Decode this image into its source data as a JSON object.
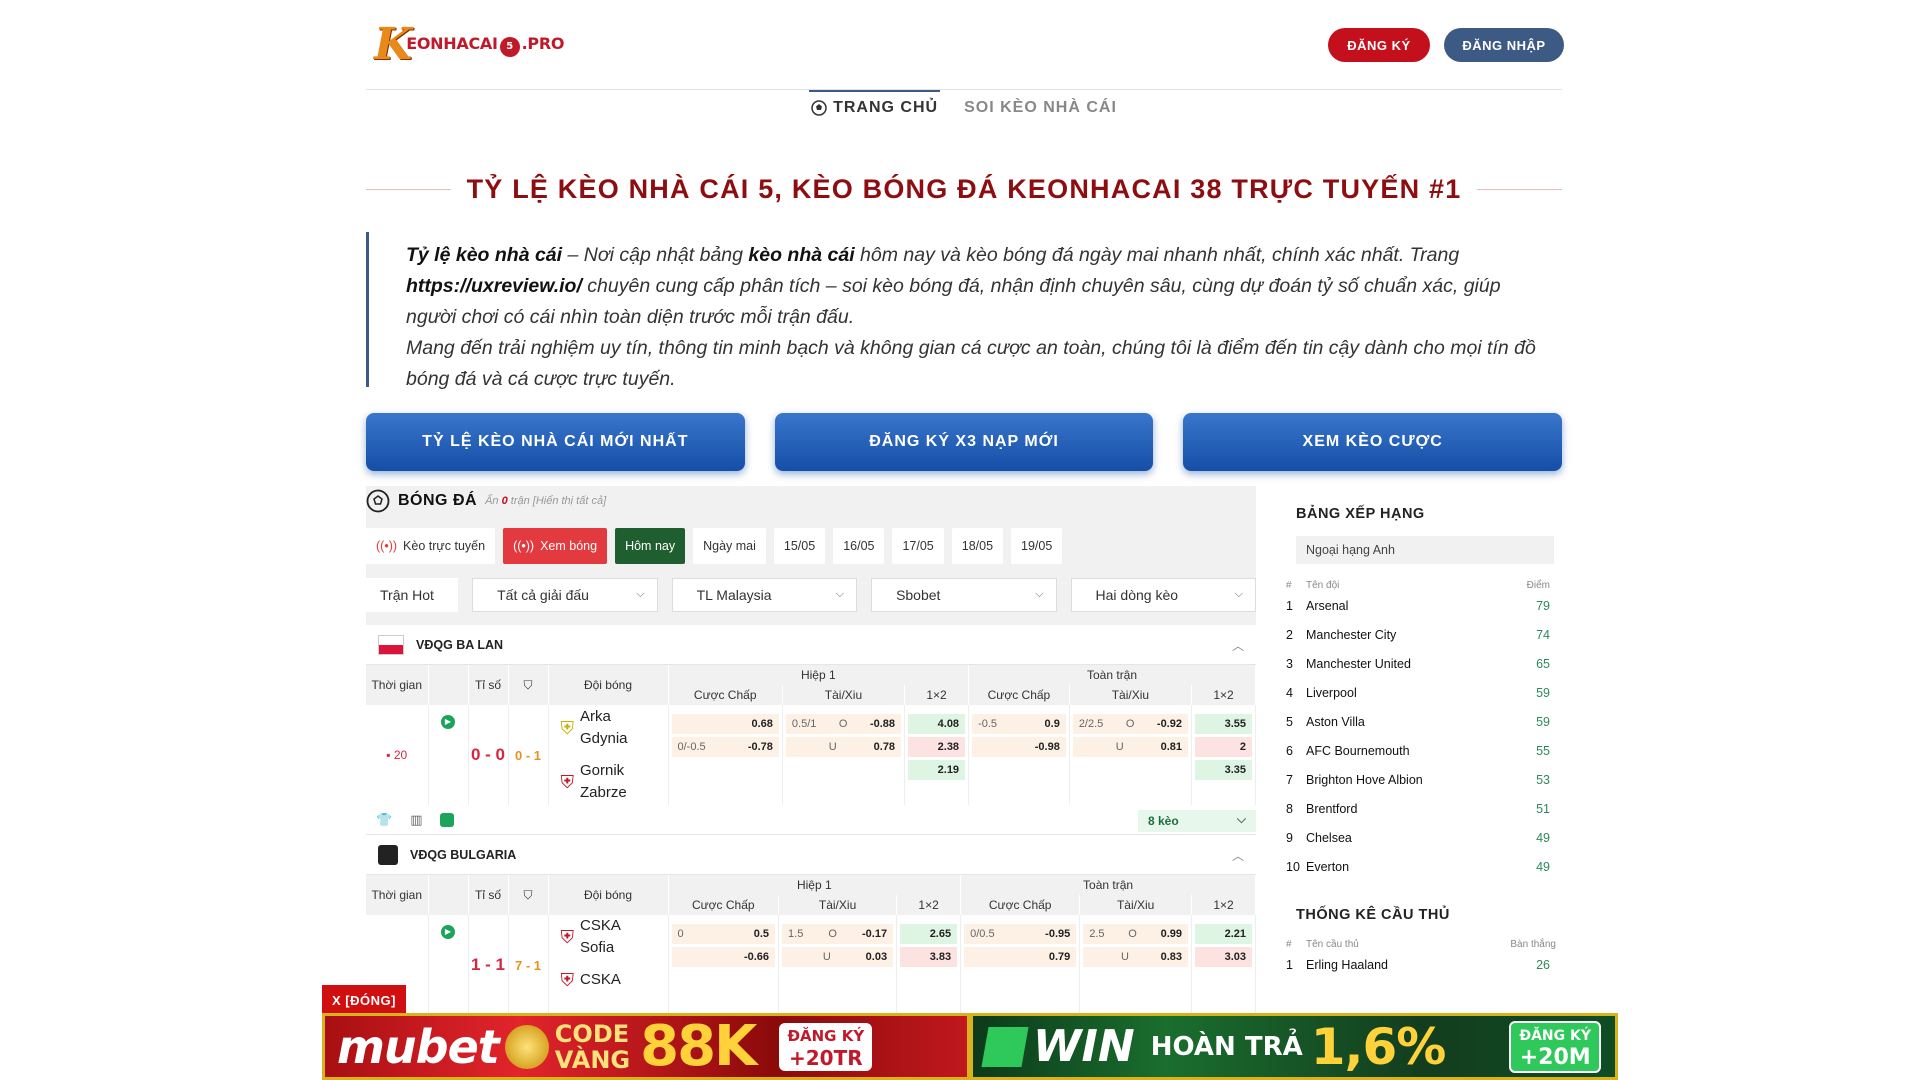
{
  "header": {
    "logo_k": "K",
    "logo_text": "EONHACAI",
    "logo_num": "5",
    "logo_tld": ".PRO",
    "register": "ĐĂNG KÝ",
    "login": "ĐĂNG NHẬP"
  },
  "nav": {
    "home": "TRANG CHỦ",
    "soi": "SOI KÈO NHÀ CÁI"
  },
  "title": "TỶ LỆ KÈO NHÀ CÁI 5, KÈO BÓNG ĐÁ KEONHACAI 38 TRỰC TUYẾN #1",
  "intro": {
    "b1": "Tỷ lệ kèo nhà cái",
    "t1": " – Nơi cập nhật bảng ",
    "b2": "kèo nhà cái",
    "t2": " hôm nay và kèo bóng đá ngày mai nhanh nhất, chính xác nhất. Trang ",
    "b3": "https://uxreview.io/",
    "t3": " chuyên cung cấp phân tích – soi kèo bóng đá, nhận định chuyên sâu, cùng dự đoán tỷ số chuẩn xác, giúp người chơi có cái nhìn toàn diện trước mỗi trận đấu.",
    "p2": "Mang đến trải nghiệm uy tín, thông tin minh bạch và không gian cá cược an toàn, chúng tôi là điểm đến tin cậy dành cho mọi tín đồ bóng đá và cá cược trực tuyến."
  },
  "bigbuttons": [
    "TỶ LỆ KÈO NHÀ CÁI MỚI NHẤT",
    "ĐĂNG KÝ X3 NẠP MỚI",
    "XEM KÈO CƯỢC"
  ],
  "section": {
    "title": "BÓNG ĐÁ",
    "sub_a": "Ẩn ",
    "sub_n": "0",
    "sub_b": " trận [Hiển thị tất cả]"
  },
  "chips": [
    "Kèo trực tuyến",
    "Xem bóng",
    "Hôm nay",
    "Ngày mai",
    "15/05",
    "16/05",
    "17/05",
    "18/05",
    "19/05"
  ],
  "filters": [
    "Trận Hot",
    "Tất cả giải đấu",
    "TL Malaysia",
    "Sbobet",
    "Hai dòng kèo"
  ],
  "table_headers": {
    "time": "Thời gian",
    "score": "Tỉ số",
    "teams": "Đội bóng",
    "h1": "Hiệp 1",
    "ft": "Toàn trận",
    "hc": "Cược Chấp",
    "ou": "Tài/Xiu",
    "x12": "1×2"
  },
  "match1": {
    "league": "VĐQG BA LAN",
    "minute": "20",
    "score": "0 - 0",
    "half": "0 - 1",
    "home": [
      "Arka",
      "Gdynia"
    ],
    "away": [
      "Gornik",
      "Zabrze"
    ],
    "h1_hc": [
      [
        "",
        "0.68"
      ],
      [
        "0/-0.5",
        "-0.78"
      ]
    ],
    "h1_ou": [
      [
        "0.5/1",
        "O",
        "-0.88"
      ],
      [
        "",
        "U",
        "0.78"
      ]
    ],
    "h1_x": [
      "4.08",
      "2.38",
      "2.19"
    ],
    "ft_hc": [
      [
        "-0.5",
        "0.9"
      ],
      [
        "",
        "-0.98"
      ]
    ],
    "ft_ou": [
      [
        "2/2.5",
        "O",
        "-0.92"
      ],
      [
        "",
        "U",
        "0.81"
      ]
    ],
    "ft_x": [
      "3.55",
      "2",
      "3.35"
    ],
    "keo": "8 kèo"
  },
  "match2": {
    "league": "VĐQG BULGARIA",
    "score": "1 - 1",
    "half": "7 - 1",
    "home": [
      "CSKA",
      "Sofia"
    ],
    "away": [
      "CSKA"
    ],
    "h1_hc": [
      [
        "0",
        "0.5"
      ],
      [
        "",
        "-0.66"
      ]
    ],
    "h1_ou": [
      [
        "1.5",
        "O",
        "-0.17"
      ],
      [
        "",
        "U",
        "0.03"
      ]
    ],
    "h1_x": [
      "2.65",
      "3.83"
    ],
    "ft_hc": [
      [
        "0/0.5",
        "-0.95"
      ],
      [
        "",
        "0.79"
      ]
    ],
    "ft_ou": [
      [
        "2.5",
        "O",
        "0.99"
      ],
      [
        "",
        "U",
        "0.83"
      ]
    ],
    "ft_x": [
      "2.21",
      "3.03"
    ]
  },
  "standings": {
    "title": "BẢNG XẾP HẠNG",
    "league": "Ngoại hạng Anh",
    "h_rank": "#",
    "h_team": "Tên đội",
    "h_pts": "Điểm",
    "rows": [
      [
        "1",
        "Arsenal",
        "79"
      ],
      [
        "2",
        "Manchester City",
        "74"
      ],
      [
        "3",
        "Manchester United",
        "65"
      ],
      [
        "4",
        "Liverpool",
        "59"
      ],
      [
        "5",
        "Aston Villa",
        "59"
      ],
      [
        "6",
        "AFC Bournemouth",
        "55"
      ],
      [
        "7",
        "Brighton Hove Albion",
        "53"
      ],
      [
        "8",
        "Brentford",
        "51"
      ],
      [
        "9",
        "Chelsea",
        "49"
      ],
      [
        "10",
        "Everton",
        "49"
      ]
    ]
  },
  "players": {
    "title": "THỐNG KÊ CẦU THỦ",
    "h_rank": "#",
    "h_name": "Tên cầu thủ",
    "h_goals": "Bàn thắng",
    "rows": [
      [
        "1",
        "Erling Haaland",
        "26"
      ]
    ]
  },
  "ad": {
    "close": "X [ĐÓNG]",
    "a1_brand": "mubet",
    "a1_code": "CODE",
    "a1_vang": "VÀNG",
    "a1_amount": "88K",
    "a1_cta1": "ĐĂNG KÝ",
    "a1_cta2": "+20TR",
    "a2_brand": "WIN",
    "a2_label": "HOÀN TRẢ",
    "a2_pct": "1,6%",
    "a2_cta1": "ĐĂNG KÝ",
    "a2_cta2": "+20M"
  },
  "colors": {
    "brand_red": "#8d0d10",
    "nav_blue": "#3c5a84",
    "button_blue": "#1f5bb5",
    "score_red": "#d8263c",
    "points_green": "#2b8a5a"
  }
}
